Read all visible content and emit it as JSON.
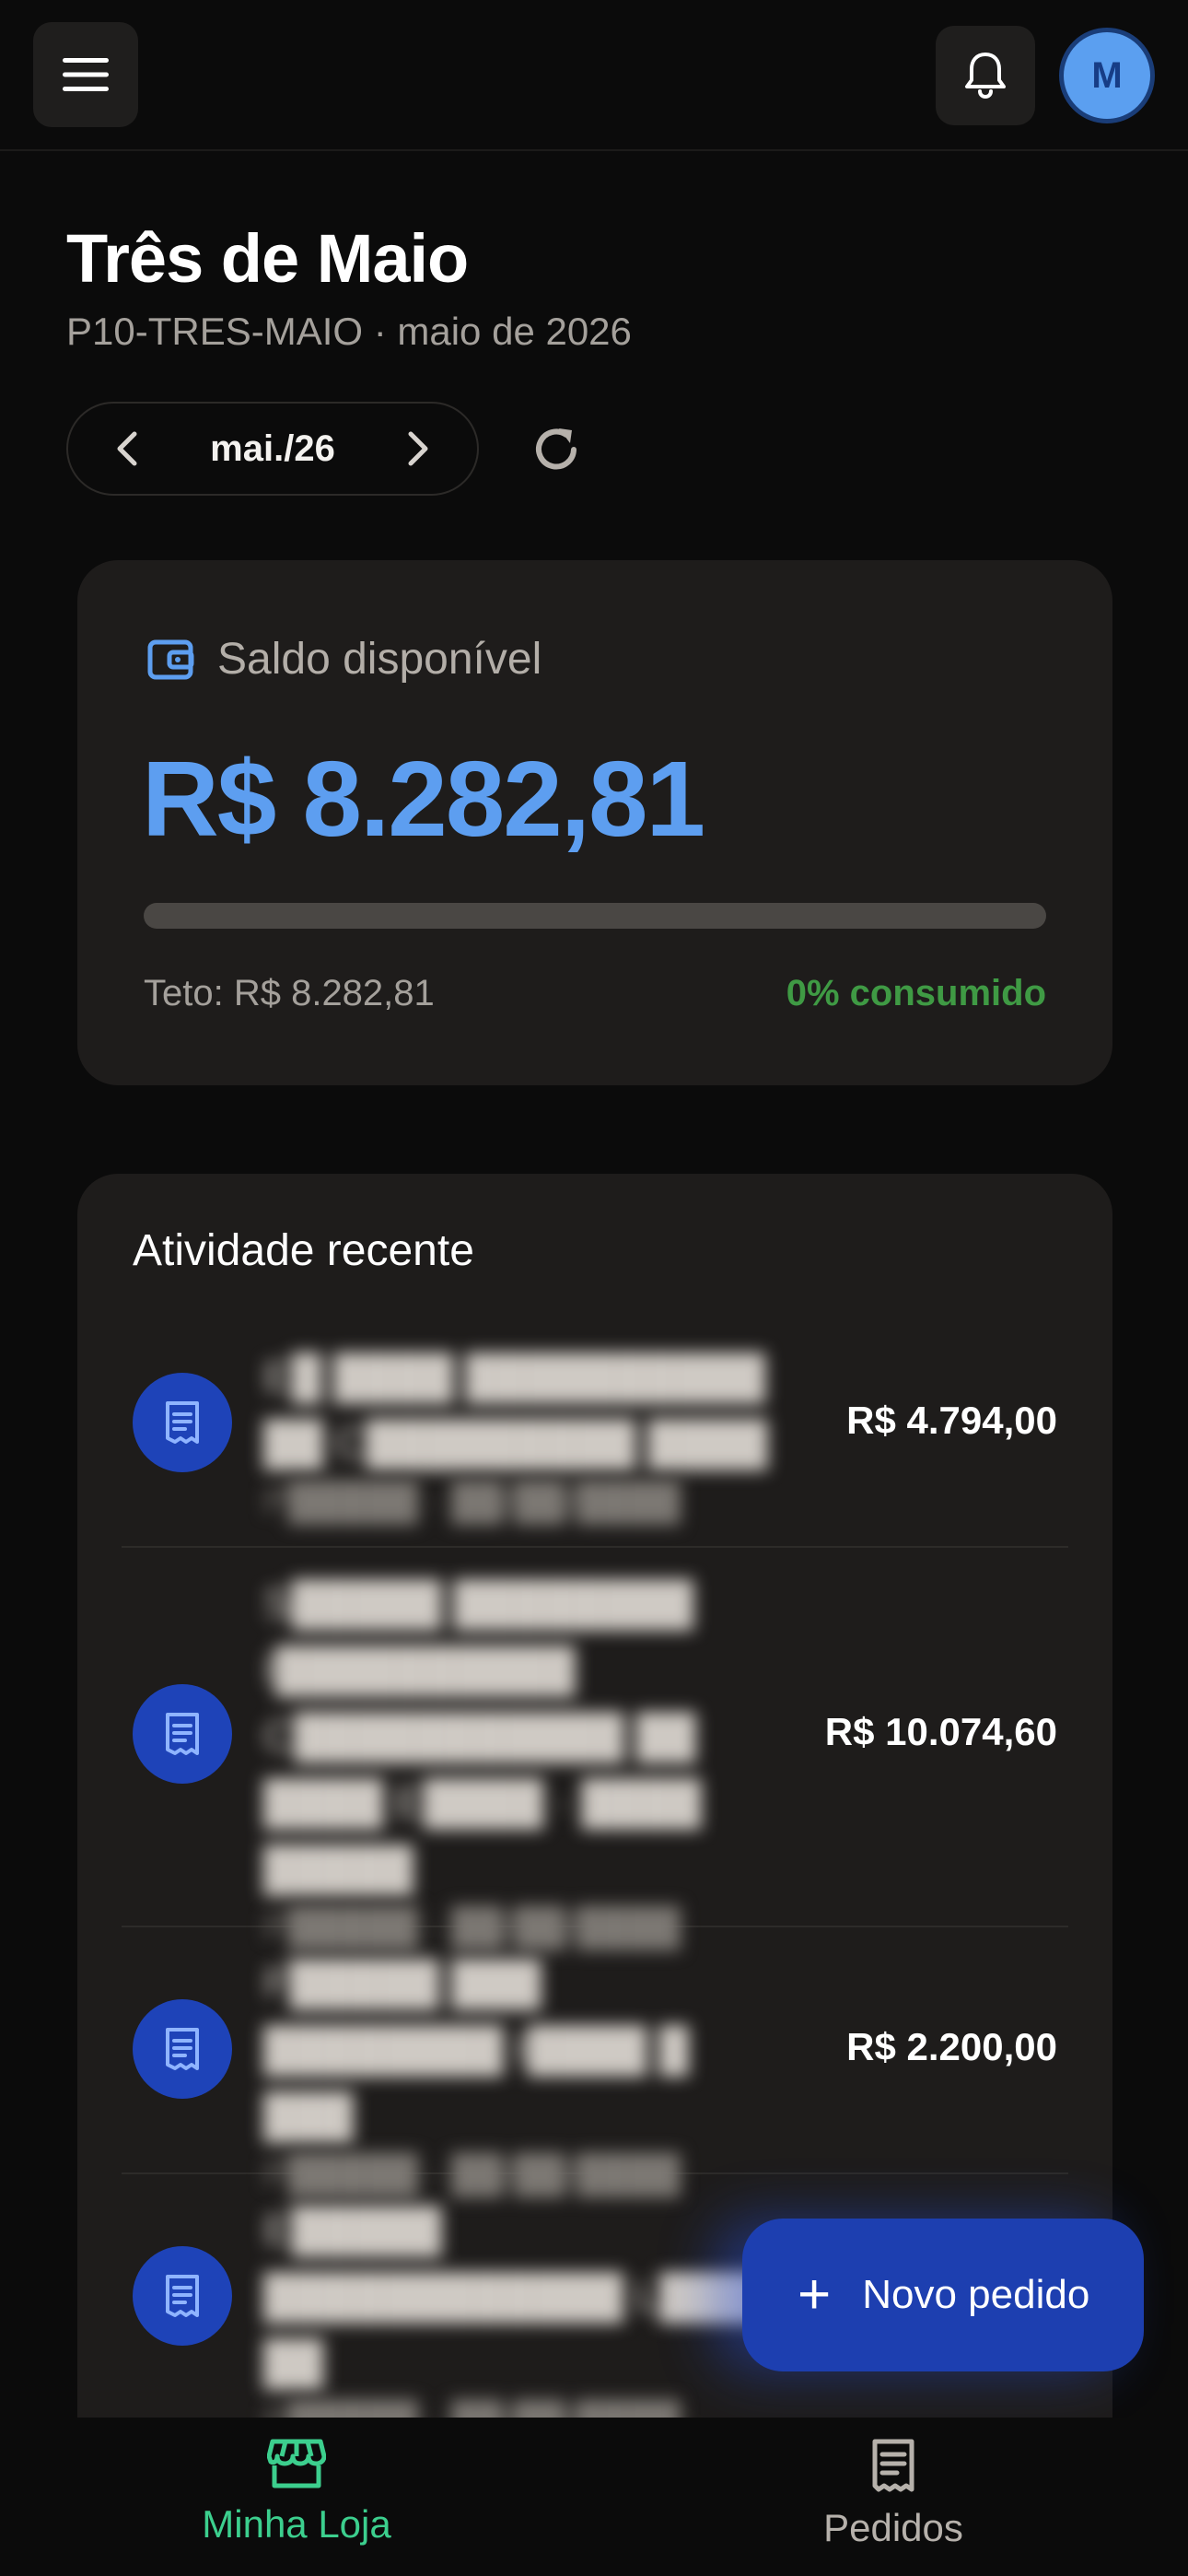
{
  "topbar": {
    "menu_icon": "hamburger-menu-icon",
    "notification_icon": "bell-icon",
    "avatar_initial": "M"
  },
  "header": {
    "title": "Três de Maio",
    "subtitle": "P10-TRES-MAIO · maio de 2026"
  },
  "period": {
    "label": "mai./26",
    "prev_icon": "chevron-left-icon",
    "next_icon": "chevron-right-icon",
    "refresh_icon": "refresh-icon"
  },
  "balance": {
    "label": "Saldo disponível",
    "value": "R$ 8.282,81",
    "ceiling": "Teto: R$ 8.282,81",
    "consumed": "0% consumido",
    "consumed_fraction": 0,
    "icon": "wallet-icon",
    "colors": {
      "value": "#5d9ef0",
      "consumed": "#3f9a44",
      "track": "#4a4744"
    }
  },
  "activity": {
    "title": "Atividade recente",
    "items": [
      {
        "name": "E█ ████ ██████████ ██ C█████████ ████",
        "meta": "P█████ · ██/██/████",
        "amount": "R$ 4.794,00"
      },
      {
        "name": "S█████ ████████ I██████████ C███████████ ██ ████ E████ · ████ █████",
        "meta": "P█████ · ██/██/████",
        "amount": "R$ 10.074,60"
      },
      {
        "name": "F█████ ███ ████████ I████ █ ███",
        "meta": "P█████ · ██/██/████",
        "amount": "R$ 2.200,00"
      },
      {
        "name": "E█████ ████████████ L████ ██",
        "meta": "P█████ · ██/██/████",
        "amount": ""
      }
    ]
  },
  "fab": {
    "plus": "+",
    "label": "Novo pedido"
  },
  "nav": {
    "store": {
      "label": "Minha Loja",
      "icon": "storefront-icon",
      "color": "#3ccf8e"
    },
    "orders": {
      "label": "Pedidos",
      "icon": "receipt-icon",
      "color": "#b6b1ab"
    }
  }
}
